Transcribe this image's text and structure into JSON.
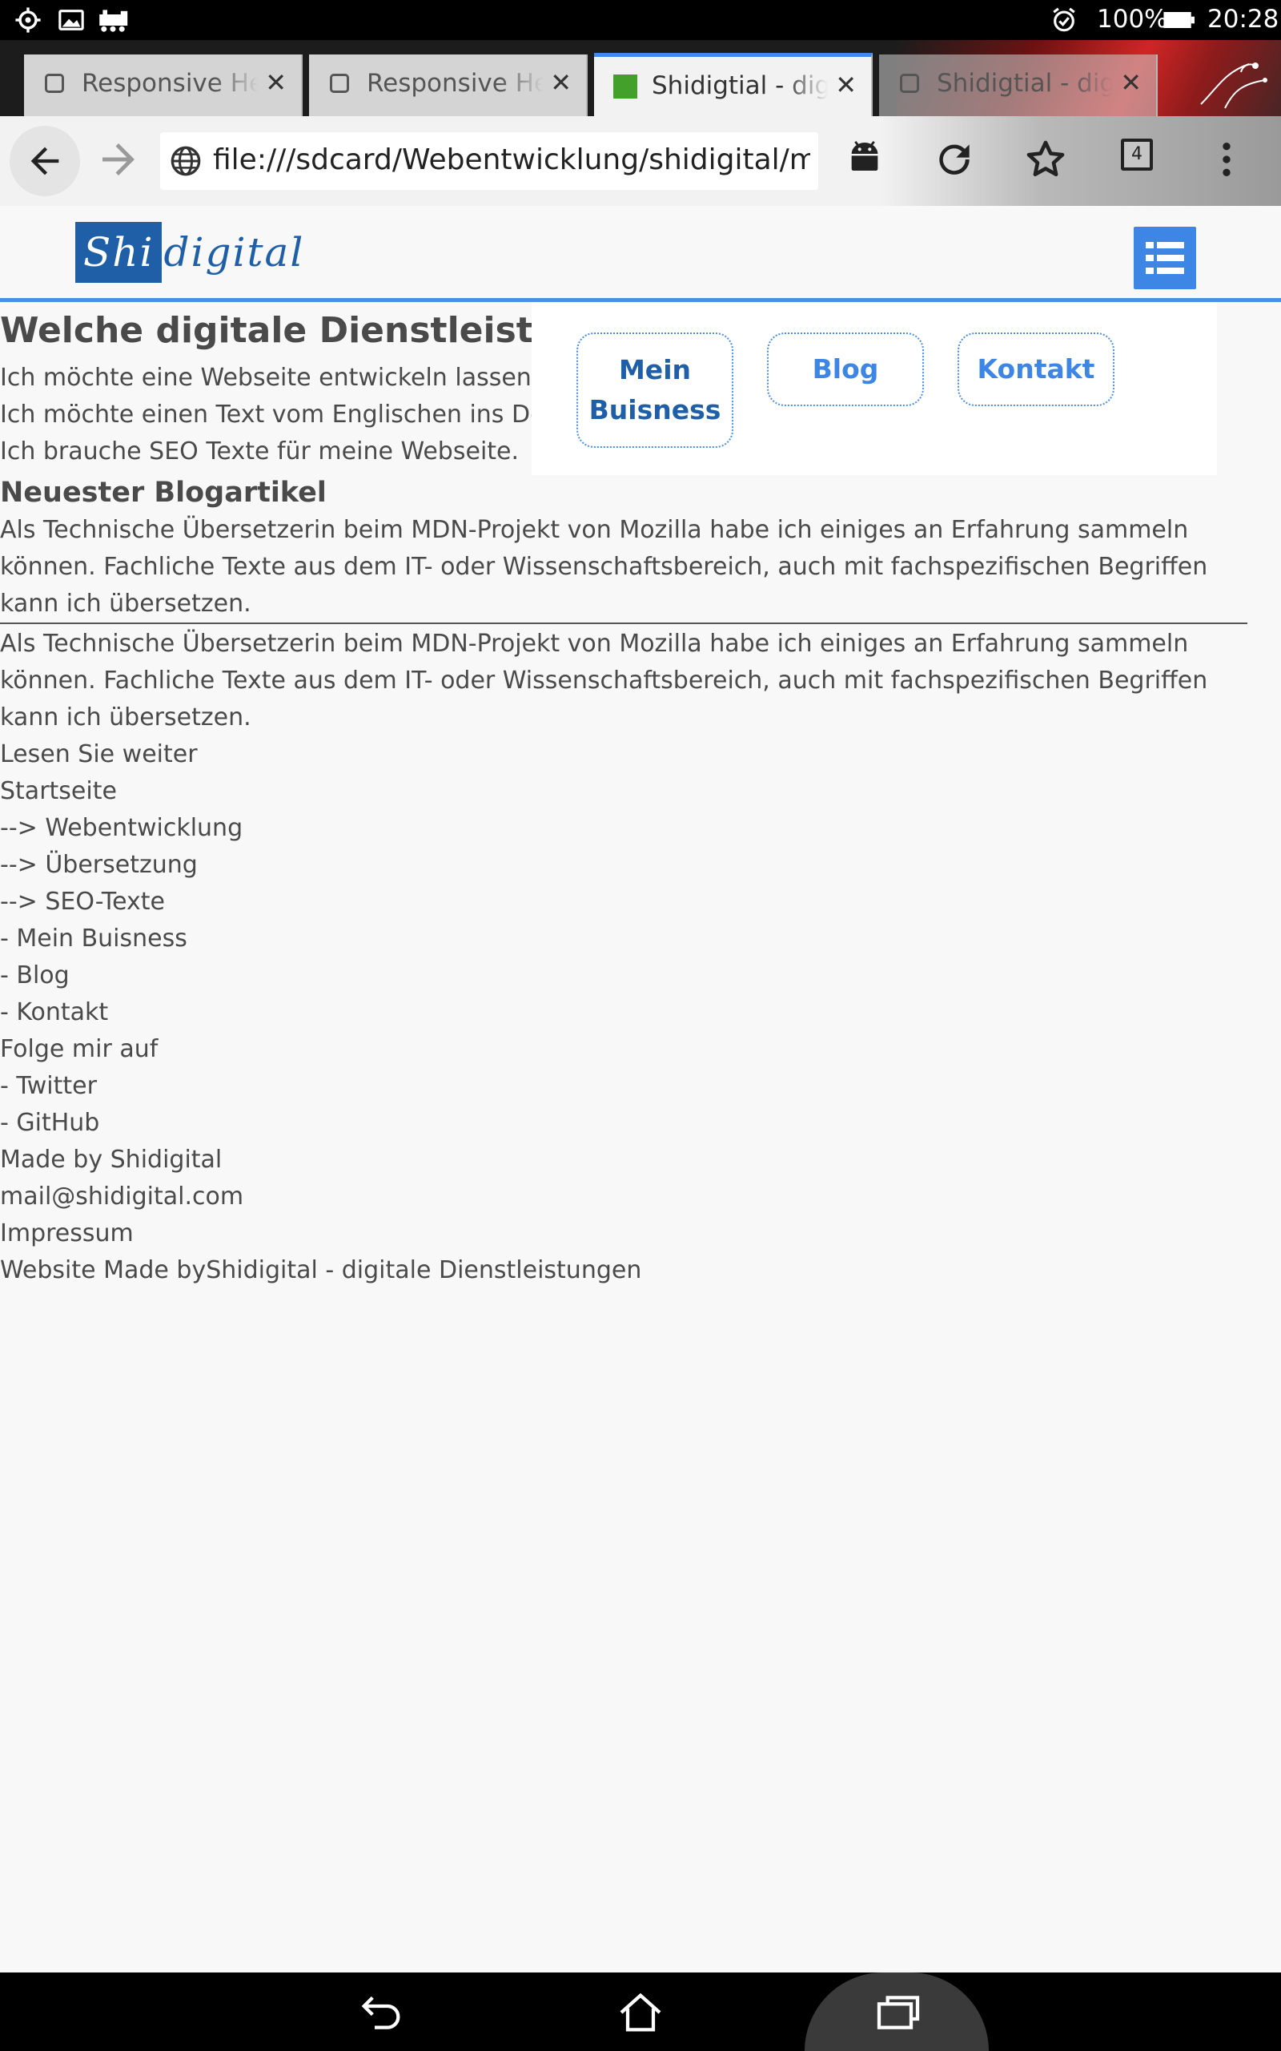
{
  "status_bar": {
    "battery": "100%",
    "time": "20:28",
    "left_icons": [
      "settings-icon",
      "image-icon",
      "train-icon"
    ],
    "right_icons": [
      "alarm-icon",
      "battery-icon"
    ]
  },
  "tabs": [
    {
      "title": "Responsive He",
      "favicon": "page-icon",
      "active": false
    },
    {
      "title": "Responsive He",
      "favicon": "page-icon",
      "active": false
    },
    {
      "title": "Shidigtial - digi",
      "favicon": "green-site-icon",
      "active": true
    },
    {
      "title": "Shidigtial - dig",
      "favicon": "page-icon",
      "active": false
    }
  ],
  "toolbar": {
    "url": "file:///sdcard/Webentwicklung/shidigital/main",
    "tab_count": "4",
    "icons": [
      "back-arrow-icon",
      "forward-arrow-icon",
      "globe-icon",
      "android-icon",
      "reload-icon",
      "star-icon",
      "tab-switcher-icon",
      "more-vert-icon"
    ]
  },
  "site": {
    "logo": {
      "part1": "Shi",
      "part2": "digital"
    },
    "menu_icon": "list-icon",
    "nav": [
      "Mein\nBuisness",
      "Blog",
      "Kontakt"
    ],
    "hero_title": "Welche digitale Dienstleistung",
    "services": [
      "Ich möchte eine Webseite entwickeln lassen.",
      "Ich möchte einen Text vom Englischen ins De",
      "Ich brauche SEO Texte für meine Webseite."
    ],
    "blog_heading": "Neuester Blogartikel",
    "blog_text": "Als Technische Übersetzerin beim MDN-Projekt von Mozilla habe ich einiges an Erfahrung sammeln können. Fachliche Texte aus dem IT- oder Wissenschaftsbereich, auch mit fachspezifischen Begriffen kann ich übersetzen.",
    "blog_text_repeat": "Als Technische Übersetzerin beim MDN-Projekt von Mozilla habe ich einiges an Erfahrung sammeln können. Fachliche Texte aus dem IT- oder Wissenschaftsbereich, auch mit fachspezifischen Begriffen kann ich übersetzen.",
    "read_more": "Lesen Sie weiter",
    "footer_lines": [
      "Startseite",
      "--> Webentwicklung",
      "--> Übersetzung",
      "--> SEO-Texte",
      "- Mein Buisness",
      "- Blog",
      "- Kontakt",
      "Folge mir auf",
      "- Twitter",
      "- GitHub",
      "Made by Shidigital",
      "mail@shidigital.com",
      "Impressum",
      "Website Made byShidigital - digitale Dienstleistungen"
    ]
  },
  "nav_bar": {
    "icons": [
      "back-icon",
      "home-icon",
      "recent-apps-icon"
    ]
  },
  "colors": {
    "accent": "#4a90e2",
    "brand": "#1e5fa8",
    "active_tab_indicator": "#4285f4"
  }
}
